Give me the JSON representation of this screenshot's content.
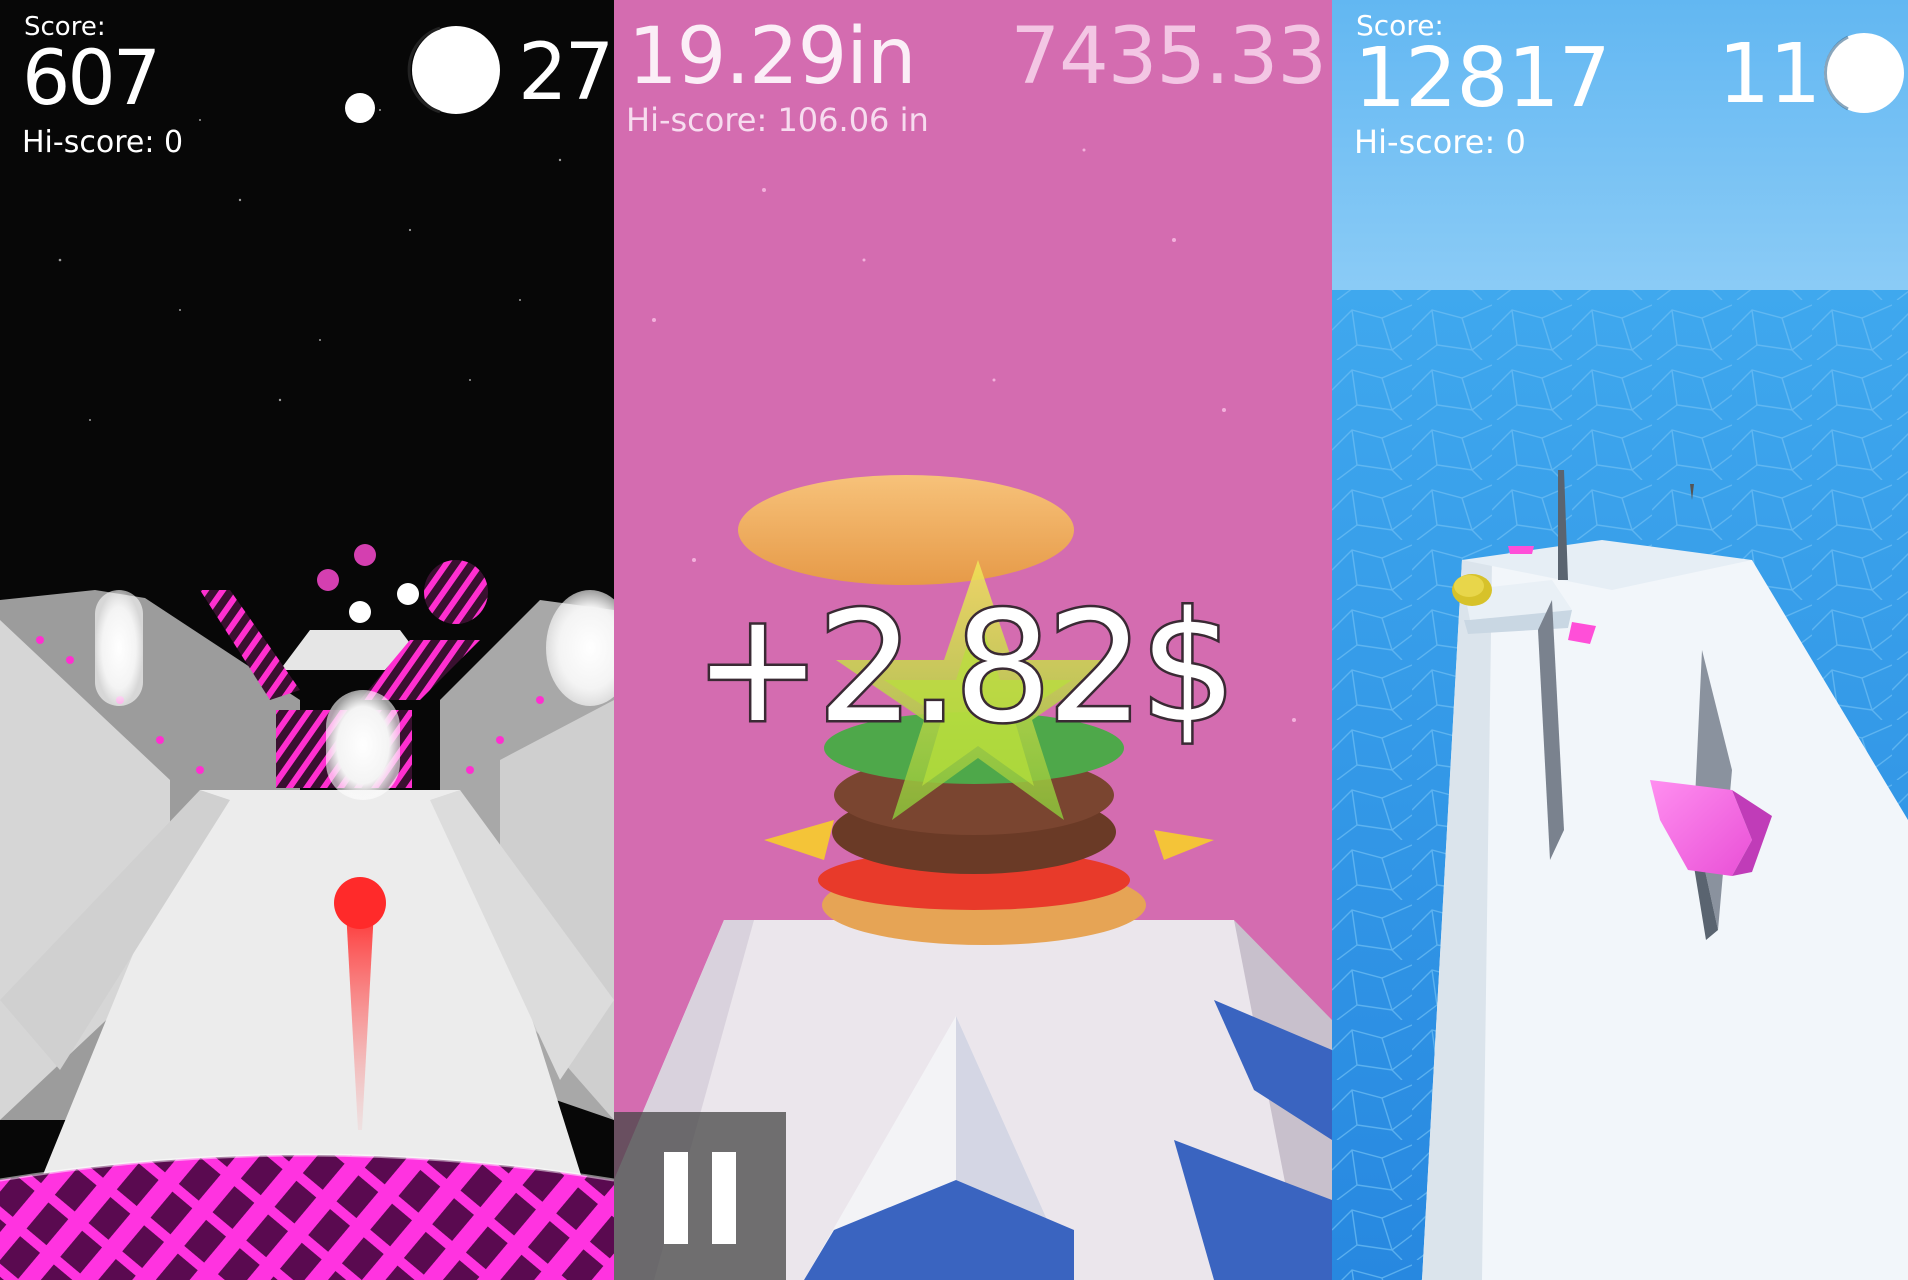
{
  "panels": [
    {
      "name": "space-runner",
      "score_label": "Score:",
      "score_value": "607",
      "hiscore": "Hi-score: 0",
      "ball_count": "27",
      "colors": {
        "background": "#070707",
        "accent": "#ff2fd0",
        "player": "#ff2a2a"
      }
    },
    {
      "name": "burger-stack",
      "height": "19.29in",
      "money": "7435.33",
      "hiscore": "Hi-score: 106.06 in",
      "bonus": "+2.82$",
      "colors": {
        "background": "#d46cb0",
        "track": "#e8e4ea",
        "stripe": "#3a64c0"
      }
    },
    {
      "name": "ocean-runner",
      "score_label": "Score:",
      "score_value": "12817",
      "hiscore": "Hi-score: 0",
      "ball_count": "11",
      "colors": {
        "background": "#5fb8f0",
        "water": "#2d9ae8",
        "track": "#f2f6fa",
        "accent": "#ff4fd8"
      }
    }
  ]
}
